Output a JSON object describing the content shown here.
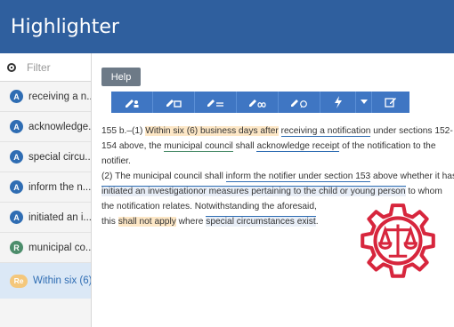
{
  "app": {
    "title": "Highlighter"
  },
  "sidebar": {
    "filter_placeholder": "Filter",
    "items": [
      {
        "badge": "A",
        "label": "receiving a n..."
      },
      {
        "badge": "A",
        "label": "acknowledge..."
      },
      {
        "badge": "A",
        "label": "special circu..."
      },
      {
        "badge": "A",
        "label": "inform the n..."
      },
      {
        "badge": "A",
        "label": "initiated an i..."
      },
      {
        "badge": "R",
        "label": "municipal co..."
      },
      {
        "badge": "Re",
        "label": "Within six (6) ..."
      }
    ]
  },
  "toolbar": {
    "help_label": "Help",
    "buttons": [
      {
        "icon": "pencil-person-icon"
      },
      {
        "icon": "pencil-box-icon"
      },
      {
        "icon": "pencil-equals-icon"
      },
      {
        "icon": "pencil-infinity-icon"
      },
      {
        "icon": "pencil-comment-icon"
      },
      {
        "icon": "lightning-icon"
      },
      {
        "icon": "caret-down-icon"
      },
      {
        "icon": "edit-icon"
      }
    ]
  },
  "document": {
    "l1_a": "155 b.–(1) ",
    "l1_b": "Within six (6) business days after",
    "l1_c": " ",
    "l1_d": "receiving a notification",
    "l1_e": " under sections 152-",
    "l2_a": "154 above, the ",
    "l2_b": "municipal council",
    "l2_c": " shall ",
    "l2_d": "acknowledge receipt",
    "l2_e": " of the notification to the",
    "l3": "notifier.",
    "l4_a": "(2) The municipal council shall ",
    "l4_b": "inform the notifier under section 153",
    "l4_c": " above whether it has",
    "l5_a": "initiated an investigationor measures pertaining to the child or young person",
    "l5_b": " to whom",
    "l6": "the notification relates. Notwithstanding the aforesaid,",
    "l7_a": "this ",
    "l7_b": "shall not apply",
    "l7_c": " where ",
    "l7_d": "special circumstances exist",
    "l7_e": "."
  },
  "colors": {
    "header": "#2f5f9e",
    "toolbar": "#3f76c3",
    "logo": "#d7263d",
    "highlight_orange": "#fde7c6"
  }
}
